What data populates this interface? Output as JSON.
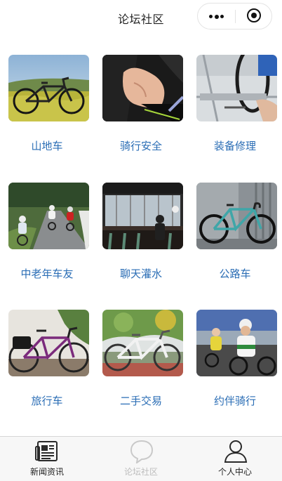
{
  "navbar": {
    "title": "论坛社区"
  },
  "categories": [
    {
      "label": "山地车",
      "icon": "mountain-bike-photo"
    },
    {
      "label": "骑行安全",
      "icon": "cycling-safety-photo"
    },
    {
      "label": "装备修理",
      "icon": "equipment-repair-photo"
    },
    {
      "label": "中老年车友",
      "icon": "senior-riders-photo"
    },
    {
      "label": "聊天灌水",
      "icon": "chat-cafe-photo"
    },
    {
      "label": "公路车",
      "icon": "road-bike-photo"
    },
    {
      "label": "旅行车",
      "icon": "touring-bike-photo"
    },
    {
      "label": "二手交易",
      "icon": "second-hand-bike-photo"
    },
    {
      "label": "约伴骑行",
      "icon": "group-ride-photo"
    }
  ],
  "tabbar": {
    "items": [
      {
        "label": "新闻资讯",
        "icon": "newspaper-icon",
        "active": false
      },
      {
        "label": "论坛社区",
        "icon": "chat-bubble-icon",
        "active": true
      },
      {
        "label": "个人中心",
        "icon": "person-icon",
        "active": false
      }
    ],
    "colors": {
      "active": "#bdbdbd",
      "inactive": "#222222",
      "link": "#2a6db5"
    }
  }
}
